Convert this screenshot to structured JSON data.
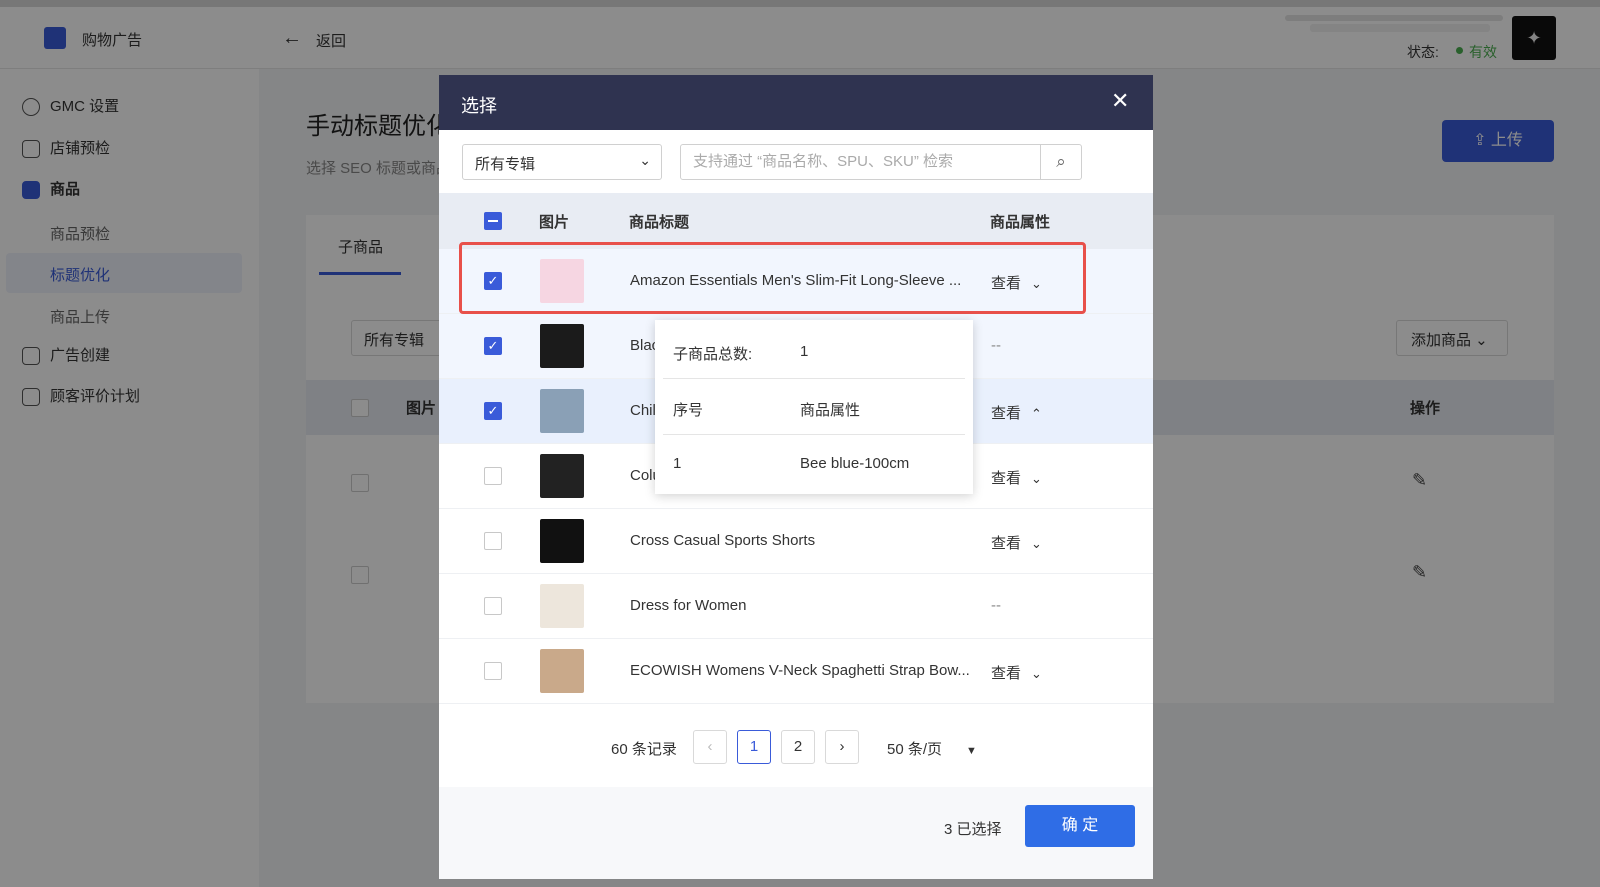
{
  "header": {
    "app_name": "购物广告",
    "back_label": "返回",
    "status_label": "状态:",
    "status_value": "有效"
  },
  "sidebar": {
    "items": [
      {
        "label": "GMC 设置"
      },
      {
        "label": "店铺预检"
      },
      {
        "label": "商品"
      },
      {
        "label": "广告创建"
      },
      {
        "label": "顾客评价计划"
      }
    ],
    "sub_items": [
      {
        "label": "商品预检"
      },
      {
        "label": "标题优化"
      },
      {
        "label": "商品上传"
      }
    ]
  },
  "page": {
    "title": "手动标题优化",
    "subtitle": "选择 SEO 标题或商品",
    "upload_label": "上传",
    "tab_sub": "子商品",
    "album_select": "所有专辑",
    "add_product_label": "添加商品",
    "col_image": "图片",
    "col_action": "操作"
  },
  "modal": {
    "title": "选择",
    "album_select": "所有专辑",
    "search_placeholder": "支持通过 “商品名称、SPU、SKU” 检索",
    "columns": {
      "image": "图片",
      "title": "商品标题",
      "attr": "商品属性"
    },
    "rows": [
      {
        "title": "Amazon Essentials Men's Slim-Fit Long-Sleeve ...",
        "attr": "查看",
        "checked": true
      },
      {
        "title": "Blac",
        "attr": "--",
        "checked": true
      },
      {
        "title": "Chil",
        "attr": "查看",
        "checked": true
      },
      {
        "title": "Colu",
        "attr": "查看",
        "checked": false
      },
      {
        "title": "Cross Casual Sports Shorts",
        "attr": "查看",
        "checked": false
      },
      {
        "title": "Dress for Women",
        "attr": "--",
        "checked": false
      },
      {
        "title": "ECOWISH Womens V-Neck Spaghetti Strap Bow...",
        "attr": "查看",
        "checked": false
      }
    ],
    "popover": {
      "total_label": "子商品总数:",
      "total_value": "1",
      "col_index": "序号",
      "col_attr": "商品属性",
      "row_index": "1",
      "row_attr": "Bee blue-100cm"
    },
    "pagination": {
      "records": "60 条记录",
      "pages": [
        "1",
        "2"
      ],
      "current": "1",
      "page_size": "50 条/页"
    },
    "selected_count": "3 已选择",
    "confirm_label": "确 定"
  },
  "colors": {
    "accent": "#3a5bd9",
    "modal_header": "#2f3350",
    "highlight": "#e8504a",
    "confirm": "#2f6de6"
  }
}
